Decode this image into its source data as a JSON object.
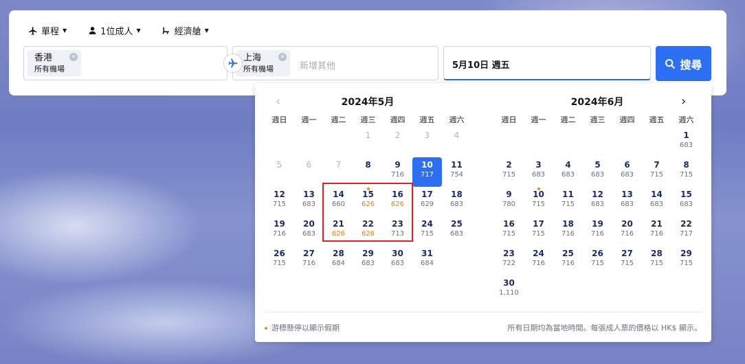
{
  "options": {
    "trip_type": "單程",
    "passengers": "1位成人",
    "cabin": "經濟艙"
  },
  "origin": {
    "city": "香港",
    "sub": "所有機場"
  },
  "destination": {
    "city": "上海",
    "sub": "所有機場",
    "add_more_placeholder": "新增其他"
  },
  "date_field": {
    "value": "5月10日 週五"
  },
  "search_button": {
    "label": "搜尋"
  },
  "calendar": {
    "weekdays": [
      "週日",
      "週一",
      "週二",
      "週三",
      "週四",
      "週五",
      "週六"
    ],
    "months": [
      {
        "title": "2024年5月",
        "offset": 3,
        "days": [
          {
            "n": "1",
            "p": "",
            "past": true
          },
          {
            "n": "2",
            "p": "",
            "past": true
          },
          {
            "n": "3",
            "p": "",
            "past": true
          },
          {
            "n": "4",
            "p": "",
            "past": true
          },
          {
            "n": "5",
            "p": "",
            "past": true
          },
          {
            "n": "6",
            "p": "",
            "past": true
          },
          {
            "n": "7",
            "p": "",
            "past": true
          },
          {
            "n": "8",
            "p": ""
          },
          {
            "n": "9",
            "p": "716"
          },
          {
            "n": "10",
            "p": "717",
            "sel": true
          },
          {
            "n": "11",
            "p": "754"
          },
          {
            "n": "12",
            "p": "715"
          },
          {
            "n": "13",
            "p": "683"
          },
          {
            "n": "14",
            "p": "660"
          },
          {
            "n": "15",
            "p": "626",
            "low": true,
            "holiday": true
          },
          {
            "n": "16",
            "p": "626",
            "low": true
          },
          {
            "n": "17",
            "p": "629"
          },
          {
            "n": "18",
            "p": "683"
          },
          {
            "n": "19",
            "p": "716"
          },
          {
            "n": "20",
            "p": "683"
          },
          {
            "n": "21",
            "p": "626",
            "low": true
          },
          {
            "n": "22",
            "p": "626",
            "low": true
          },
          {
            "n": "23",
            "p": "713"
          },
          {
            "n": "24",
            "p": "715"
          },
          {
            "n": "25",
            "p": "683"
          },
          {
            "n": "26",
            "p": "715"
          },
          {
            "n": "27",
            "p": "716"
          },
          {
            "n": "28",
            "p": "684"
          },
          {
            "n": "29",
            "p": "683"
          },
          {
            "n": "30",
            "p": "683"
          },
          {
            "n": "31",
            "p": "684"
          }
        ]
      },
      {
        "title": "2024年6月",
        "offset": 6,
        "days": [
          {
            "n": "1",
            "p": "683"
          },
          {
            "n": "2",
            "p": "715"
          },
          {
            "n": "3",
            "p": "683"
          },
          {
            "n": "4",
            "p": "683"
          },
          {
            "n": "5",
            "p": "683"
          },
          {
            "n": "6",
            "p": "683"
          },
          {
            "n": "7",
            "p": "715"
          },
          {
            "n": "8",
            "p": "715"
          },
          {
            "n": "9",
            "p": "780"
          },
          {
            "n": "10",
            "p": "715",
            "holiday": true
          },
          {
            "n": "11",
            "p": "715"
          },
          {
            "n": "12",
            "p": "683"
          },
          {
            "n": "13",
            "p": "683"
          },
          {
            "n": "14",
            "p": "683"
          },
          {
            "n": "15",
            "p": "683"
          },
          {
            "n": "16",
            "p": "715"
          },
          {
            "n": "17",
            "p": "715"
          },
          {
            "n": "18",
            "p": "716"
          },
          {
            "n": "19",
            "p": "716"
          },
          {
            "n": "20",
            "p": "716"
          },
          {
            "n": "21",
            "p": "716"
          },
          {
            "n": "22",
            "p": "717"
          },
          {
            "n": "23",
            "p": "722"
          },
          {
            "n": "24",
            "p": "716"
          },
          {
            "n": "25",
            "p": "716"
          },
          {
            "n": "26",
            "p": "715"
          },
          {
            "n": "27",
            "p": "715"
          },
          {
            "n": "28",
            "p": "715"
          },
          {
            "n": "29",
            "p": "715"
          },
          {
            "n": "30",
            "p": "1,110"
          }
        ]
      }
    ],
    "footer_left": "游標懸停以顯示假期",
    "footer_right": "所有日期均為當地時間。每張成人票的價格以 HK$ 顯示。"
  }
}
